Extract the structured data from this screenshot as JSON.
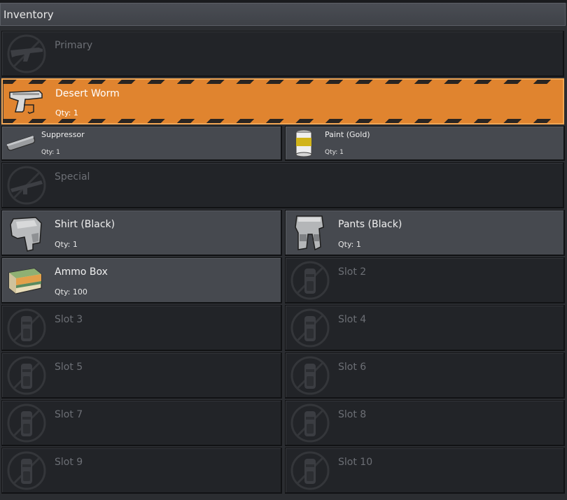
{
  "title": "Inventory",
  "primary": {
    "label": "Primary",
    "icon": "rifle-icon"
  },
  "selected_item": {
    "name": "Desert Worm",
    "qty": "Qty: 1",
    "icon": "pistol-icon"
  },
  "attachments": [
    {
      "name": "Suppressor",
      "qty": "Qty: 1",
      "icon": "suppressor-icon"
    },
    {
      "name": "Paint (Gold)",
      "qty": "Qty: 1",
      "icon": "paint-can-icon"
    }
  ],
  "special": {
    "label": "Special",
    "icon": "rocket-launcher-icon"
  },
  "clothing": [
    {
      "name": "Shirt (Black)",
      "qty": "Qty: 1",
      "icon": "shirt-icon"
    },
    {
      "name": "Pants (Black)",
      "qty": "Qty: 1",
      "icon": "pants-icon"
    }
  ],
  "ammo": {
    "name": "Ammo Box",
    "qty": "Qty: 100",
    "icon": "ammo-box-icon"
  },
  "empty_slots": [
    "Slot 2",
    "Slot 3",
    "Slot 4",
    "Slot 5",
    "Slot 6",
    "Slot 7",
    "Slot 8",
    "Slot 9",
    "Slot 10"
  ],
  "colors": {
    "selected": "#e0842f",
    "filled": "#46494f",
    "empty": "#222428"
  }
}
